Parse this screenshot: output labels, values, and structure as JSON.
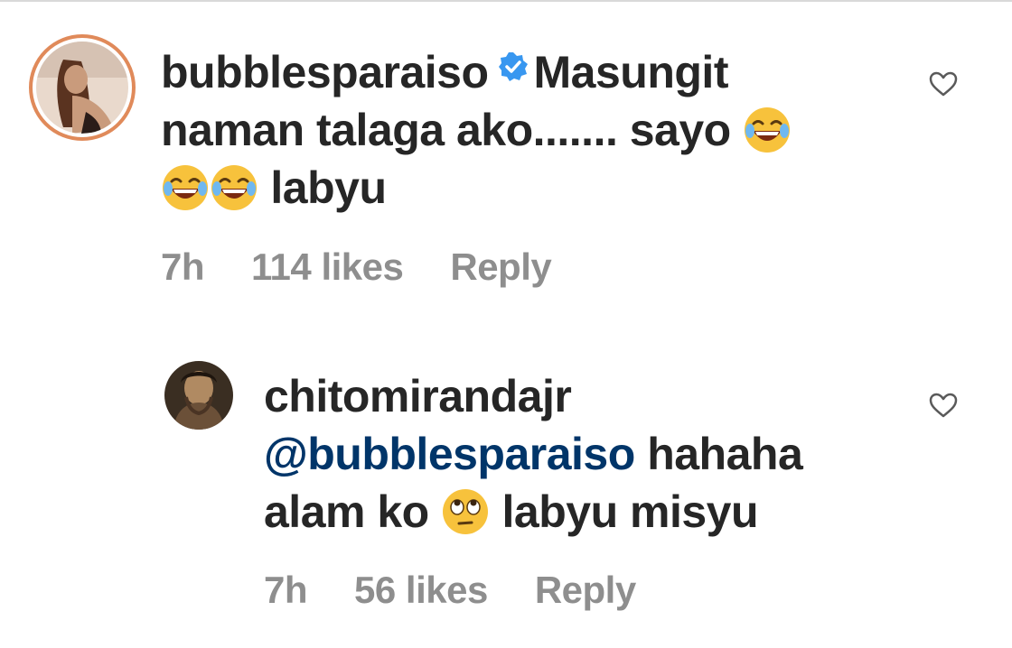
{
  "comments": [
    {
      "username": "bubblesparaiso",
      "verified": true,
      "text_line1": "Masungit",
      "text_line2": "naman talaga ako....... sayo",
      "text_line3": "labyu",
      "time": "7h",
      "likes": "114 likes",
      "reply": "Reply",
      "heart_icon": "heart-outline-icon"
    },
    {
      "username": "chitomirandajr",
      "mention": "@bubblesparaiso",
      "text_line2a": "hahaha",
      "text_line3a": "alam ko",
      "text_line3b": "labyu misyu",
      "time": "7h",
      "likes": "56 likes",
      "reply": "Reply",
      "heart_icon": "heart-outline-icon"
    }
  ],
  "colors": {
    "text": "#262626",
    "meta": "#8e8e8e",
    "mention": "#003569",
    "verified": "#3897f0",
    "story_ring": "#e08a5a"
  }
}
